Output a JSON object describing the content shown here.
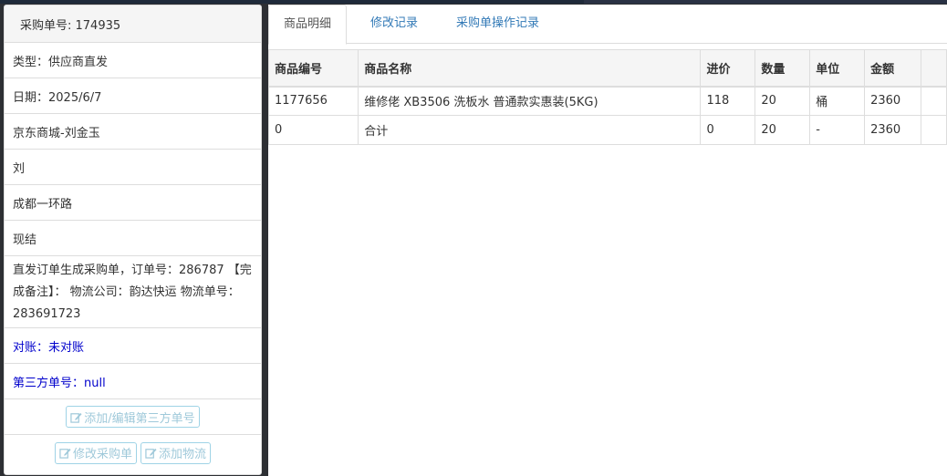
{
  "left_panel": {
    "header": "采购单号: 174935",
    "rows": [
      "类型：供应商直发",
      "日期：2025/6/7",
      "京东商城-刘金玉",
      "刘",
      "成都一环路",
      "现结"
    ],
    "note": "直发订单生成采购单，订单号：286787 【完成备注】： 物流公司：韵达快运 物流单号：283691723",
    "reconcile": "对账：未对账",
    "third_party": "第三方单号：null",
    "buttons": {
      "edit_third_party": "添加/编辑第三方单号",
      "edit_order": "修改采购单",
      "add_logistics": "添加物流"
    }
  },
  "tabs": [
    "商品明细",
    "修改记录",
    "采购单操作记录"
  ],
  "table": {
    "columns": [
      "商品编号",
      "商品名称",
      "进价",
      "数量",
      "单位",
      "金额"
    ],
    "rows": [
      [
        "1177656",
        "维修佬 XB3506 洗板水 普通款实惠装(5KG)",
        "118",
        "20",
        "桶",
        "2360"
      ],
      [
        "0",
        "合计",
        "0",
        "20",
        "-",
        "2360"
      ]
    ]
  }
}
